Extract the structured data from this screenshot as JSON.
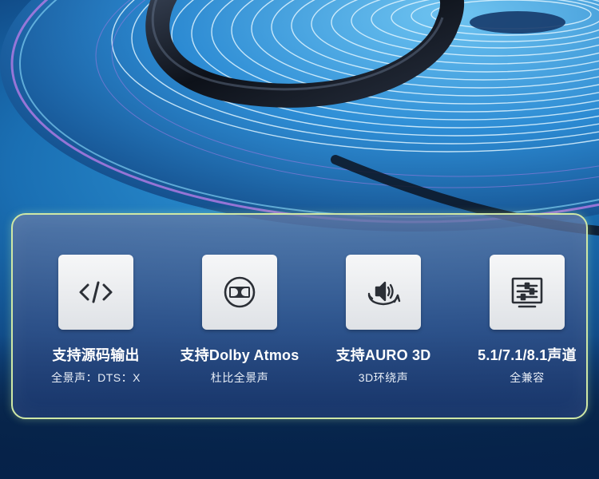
{
  "features": [
    {
      "icon": "code-icon",
      "title": "支持源码输出",
      "subtitle": "全景声：DTS：X"
    },
    {
      "icon": "dolby-icon",
      "title": "支持Dolby Atmos",
      "subtitle": "杜比全景声"
    },
    {
      "icon": "surround-sound-icon",
      "title": "支持AURO 3D",
      "subtitle": "3D环绕声"
    },
    {
      "icon": "channel-settings-icon",
      "title": "5.1/7.1/8.1声道",
      "subtitle": "全兼容"
    }
  ],
  "colors": {
    "panel_border": "#cfe8a6",
    "icon_stroke": "#2b2f36",
    "text": "#ffffff"
  }
}
